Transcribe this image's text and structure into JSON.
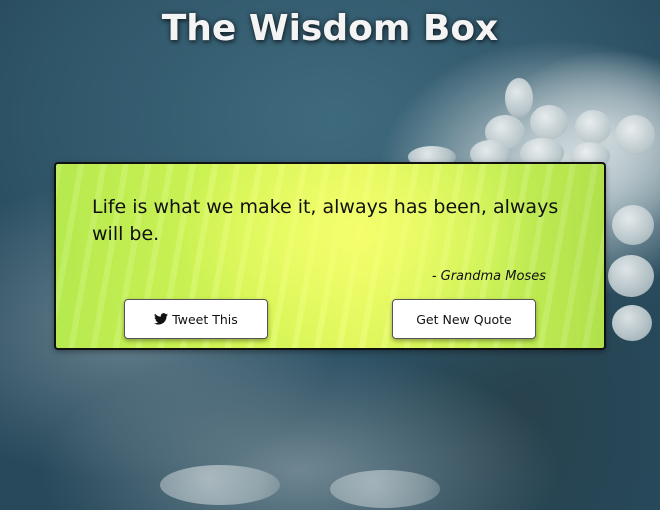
{
  "header": {
    "title": "The Wisdom Box"
  },
  "quote": {
    "text": "Life is what we make it, always has been, always will be.",
    "author": "- Grandma Moses"
  },
  "buttons": {
    "tweet_label": "Tweet This",
    "tweet_icon": "twitter-icon",
    "new_quote_label": "Get New Quote"
  },
  "colors": {
    "card_accent": "#d8f85a",
    "background": "#2f5568"
  }
}
